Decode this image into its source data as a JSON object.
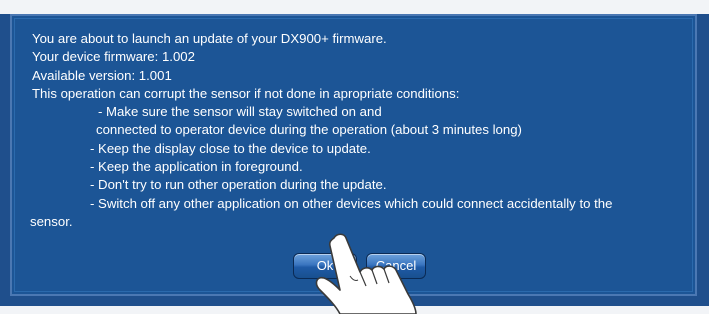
{
  "dialog": {
    "lines": [
      "You are about to launch an update of your DX900+ firmware.",
      "Your device firmware: 1.002",
      "Available version: 1.001",
      "This operation can corrupt the sensor if not done in apropriate conditions:",
      "- Make sure the sensor will stay switched on and",
      "connected to operator device during the operation (about 3 minutes long)",
      "- Keep the display close to the device to update.",
      "- Keep the application in foreground.",
      "- Don't try to run other operation during the update.",
      "- Switch off any other application on other devices which could connect accidentally to the",
      "sensor."
    ]
  },
  "buttons": {
    "ok_label": "Ok",
    "cancel_label": "Cancel"
  },
  "icons": {
    "pointer": "hand-pointer-icon"
  },
  "colors": {
    "dialog_background": "#1c5596",
    "text": "#ffffff",
    "button": "#3a75bf"
  }
}
